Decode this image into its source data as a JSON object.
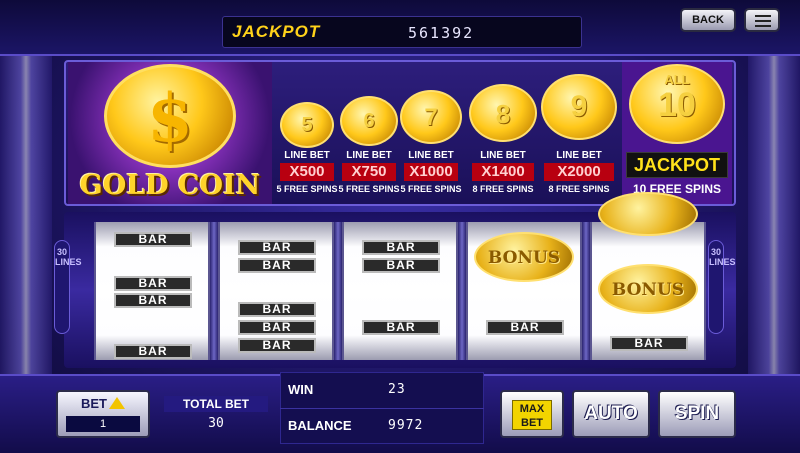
{
  "top": {
    "jackpot_label": "JACKPOT",
    "jackpot_value": "561392",
    "back_label": "BACK",
    "menu_icon": "menu-icon"
  },
  "paytable": {
    "title": "GOLD COIN",
    "coin_symbol": "$",
    "columns": [
      {
        "coin": "5",
        "line_bet": "LINE BET",
        "multiplier": "X500",
        "spins": "5 FREE SPINS"
      },
      {
        "coin": "6",
        "line_bet": "LINE BET",
        "multiplier": "X750",
        "spins": "5 FREE SPINS"
      },
      {
        "coin": "7",
        "line_bet": "LINE BET",
        "multiplier": "X1000",
        "spins": "5 FREE SPINS"
      },
      {
        "coin": "8",
        "line_bet": "LINE BET",
        "multiplier": "X1400",
        "spins": "8 FREE SPINS"
      },
      {
        "coin": "9",
        "line_bet": "LINE BET",
        "multiplier": "X2000",
        "spins": "8 FREE SPINS"
      }
    ],
    "jackpot_column": {
      "coin_top": "ALL",
      "coin": "10",
      "label": "JACKPOT",
      "spins": "10 FREE SPINS"
    }
  },
  "reels": {
    "lines_label": "30 LINES",
    "bar_text": "BAR",
    "bonus_text": "BONUS"
  },
  "bottom": {
    "bet_label": "BET",
    "bet_value": "1",
    "total_bet_label": "TOTAL BET",
    "total_bet_value": "30",
    "win_label": "WIN",
    "win_value": "23",
    "balance_label": "BALANCE",
    "balance_value": "9972",
    "max_bet_label": "MAX BET",
    "auto_label": "AUTO",
    "spin_label": "SPIN"
  },
  "colors": {
    "accent_gold": "#ffd21a",
    "multiplier_red": "#b80010",
    "background": "#1c1460"
  }
}
